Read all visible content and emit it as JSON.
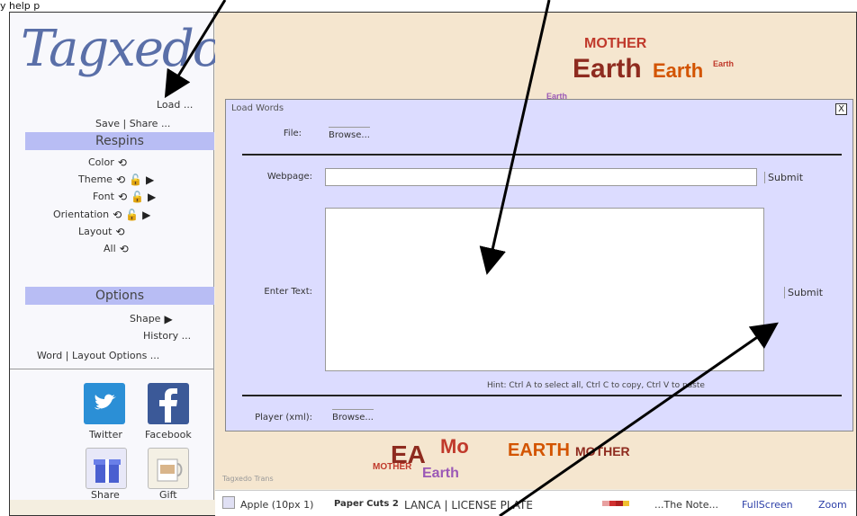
{
  "top_caption": "y help p",
  "sidebar": {
    "logo": "Tagxedo",
    "load_label": "Load ...",
    "save_share_label": "Save | Share ...",
    "respins_header": "Respins",
    "respin_items": [
      {
        "label": "Color"
      },
      {
        "label": "Theme"
      },
      {
        "label": "Font"
      },
      {
        "label": "Orientation"
      },
      {
        "label": "Layout"
      },
      {
        "label": "All"
      }
    ],
    "options_header": "Options",
    "shape_label": "Shape",
    "history_label": "History ...",
    "word_layout_label": "Word | Layout Options ...",
    "share_tiles": [
      {
        "label": "Twitter",
        "color": "#2b8fd6"
      },
      {
        "label": "Facebook",
        "color": "#3b5998"
      },
      {
        "label": "Share"
      },
      {
        "label": "Gift"
      }
    ]
  },
  "canvas": {
    "words_top": [
      "MOTHER",
      "Earth",
      "Earth",
      "Earth",
      "Earth"
    ],
    "words_bottom": [
      "EA",
      "Mo",
      "EARTH",
      "MOTHER",
      "Earth",
      "MOTHER"
    ],
    "accent_colors": [
      "#c0392b",
      "#8e2b1f",
      "#d35400",
      "#9b59b6"
    ],
    "bottom_left_text": "Tagxedo Trans"
  },
  "dialog": {
    "title": "Load Words",
    "close": "X",
    "file_label": "File:",
    "file_button": "Browse...",
    "webpage_label": "Webpage:",
    "webpage_value": "",
    "webpage_submit": "Submit",
    "enter_text_label": "Enter Text:",
    "enter_text_value": "",
    "enter_text_submit": "Submit",
    "hint": "Hint: Ctrl A to select all, Ctrl C to copy, Ctrl V to paste",
    "player_label": "Player (xml):",
    "player_button": "Browse..."
  },
  "bottombar": {
    "font_name": "Apple (10px 1)",
    "paper": "Paper Cuts 2",
    "license": "LANCA | LICENSE PLATE",
    "note": "...The Note...",
    "fullscreen": "FullScreen",
    "zoom": "Zoom",
    "color_swatches": [
      "#e8a0a0",
      "#d03030",
      "#b02020",
      "#f0c030"
    ]
  }
}
